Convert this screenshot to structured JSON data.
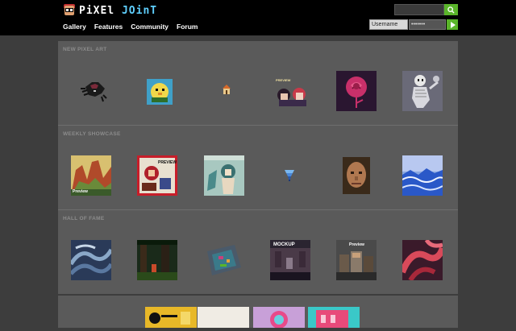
{
  "logo": {
    "part1": "PiXEl",
    "part2": "JOinT"
  },
  "nav": {
    "items": [
      "Gallery",
      "Features",
      "Community",
      "Forum"
    ]
  },
  "search": {
    "placeholder": ""
  },
  "login": {
    "username_placeholder": "Username",
    "password_value": "•••••••"
  },
  "sections": [
    {
      "title": "NEW PIXEL ART"
    },
    {
      "title": "WEEKLY SHOWCASE"
    },
    {
      "title": "HALL OF FAME"
    }
  ],
  "thumb_labels": {
    "preview": "PREVIEW",
    "preview_small": "Preview",
    "mockup": "MOCKUP"
  },
  "colors": {
    "accent_green": "#5ab52a",
    "panel": "#5a5a5a",
    "background": "#3d3d3d"
  }
}
